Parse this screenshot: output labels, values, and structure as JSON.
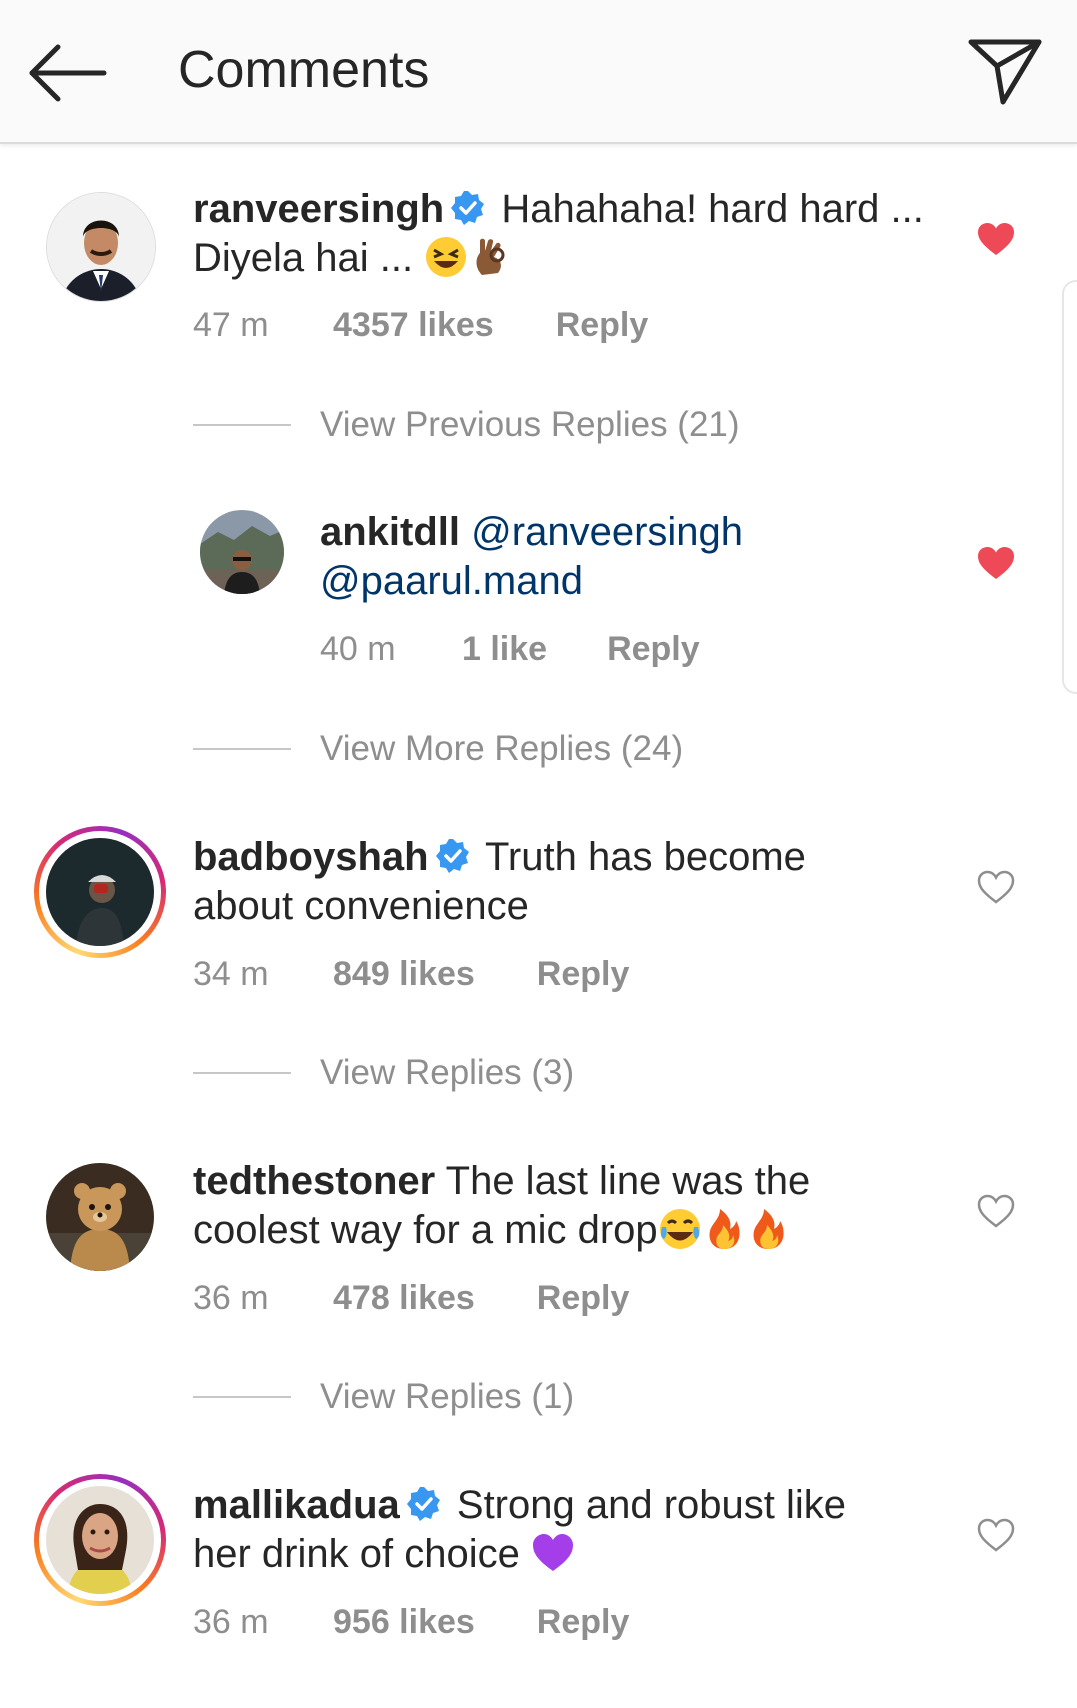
{
  "header": {
    "title": "Comments"
  },
  "comments": [
    {
      "username": "ranveersingh",
      "verified": true,
      "text": "Hahahaha! hard hard ... Diyela hai ...",
      "text_line1": "Hahahaha! hard hard ...",
      "text_line2": "Diyela hai ...",
      "emojis": [
        "grinning-squinting-face",
        "ok-hand"
      ],
      "time": "47 m",
      "likes": "4357 likes",
      "reply": "Reply",
      "liked": true,
      "story_ring": false,
      "replies_link": "View Previous Replies (21)"
    },
    {
      "username": "ankitdll",
      "verified": false,
      "mention1": "@ranveersingh",
      "mention2": "@paarul.mand",
      "time": "40 m",
      "likes": "1 like",
      "reply": "Reply",
      "liked": true,
      "is_reply": true,
      "replies_link": "View More Replies (24)"
    },
    {
      "username": "badboyshah",
      "verified": true,
      "text_line1": "Truth has become",
      "text_line2": "about convenience",
      "time": "34 m",
      "likes": "849 likes",
      "reply": "Reply",
      "liked": false,
      "story_ring": true,
      "replies_link": "View Replies (3)"
    },
    {
      "username": "tedthestoner",
      "verified": false,
      "text_line1": "The last line was the",
      "text_line2": "coolest way for a mic drop",
      "emojis": [
        "face-with-tears-of-joy",
        "fire",
        "fire"
      ],
      "time": "36 m",
      "likes": "478 likes",
      "reply": "Reply",
      "liked": false,
      "story_ring": false,
      "replies_link": "View Replies (1)"
    },
    {
      "username": "mallikadua",
      "verified": true,
      "text_line1": "Strong and robust like",
      "text_line2": "her drink of choice",
      "emojis": [
        "purple-heart"
      ],
      "time": "36 m",
      "likes": "956 likes",
      "reply": "Reply",
      "liked": false,
      "story_ring": true
    }
  ],
  "colors": {
    "liked_heart": "#ed4956",
    "verified": "#3897f0",
    "meta_text": "#8e8e8e",
    "mention": "#003569"
  }
}
